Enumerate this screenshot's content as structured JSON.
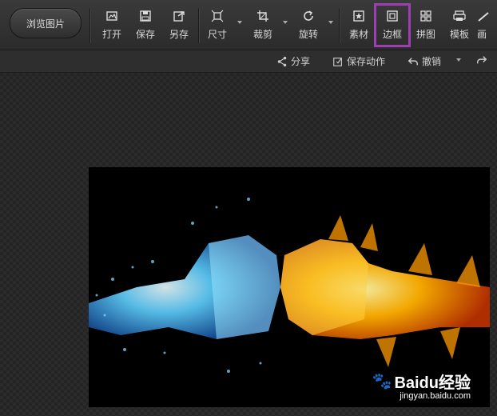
{
  "toolbar": {
    "browse_label": "浏览图片",
    "tools": [
      {
        "label": "打开",
        "icon": "open-icon"
      },
      {
        "label": "保存",
        "icon": "save-icon"
      },
      {
        "label": "另存",
        "icon": "save-as-icon"
      },
      {
        "label": "尺寸",
        "icon": "resize-icon"
      },
      {
        "label": "裁剪",
        "icon": "crop-icon"
      },
      {
        "label": "旋转",
        "icon": "rotate-icon"
      },
      {
        "label": "素材",
        "icon": "material-icon"
      },
      {
        "label": "边框",
        "icon": "border-icon"
      },
      {
        "label": "拼图",
        "icon": "collage-icon"
      },
      {
        "label": "模板",
        "icon": "template-icon"
      },
      {
        "label": "画",
        "icon": "draw-icon"
      }
    ],
    "highlighted_tool": "边框",
    "highlight_color": "#9b3fb1"
  },
  "subbar": {
    "share_label": "分享",
    "save_action_label": "保存动作",
    "undo_label": "撤销"
  },
  "photo": {
    "subject": "ice fist and fire fist colliding",
    "watermark_brand": "Baidu经验",
    "watermark_url": "jingyan.baidu.com"
  }
}
